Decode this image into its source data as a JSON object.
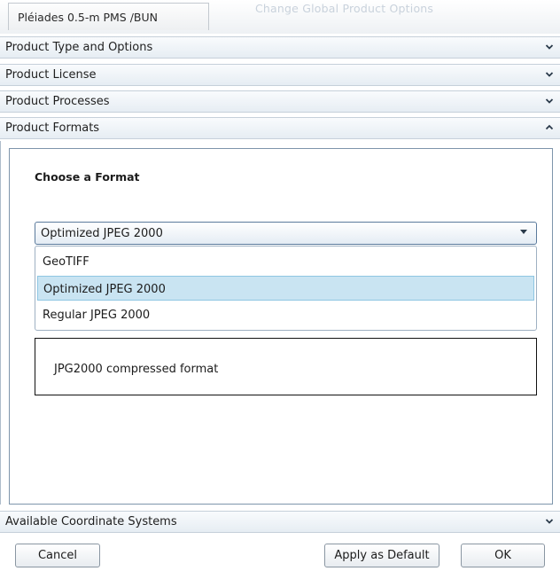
{
  "window": {
    "title": "Pléiades 0.5-m PMS /BUN",
    "ghost_title": "Change Global Product Options"
  },
  "accordion": {
    "sections": [
      {
        "label": "Product Type and Options",
        "state": "collapsed",
        "icon": "chevron-down-icon"
      },
      {
        "label": "Product License",
        "state": "collapsed",
        "icon": "chevron-down-icon"
      },
      {
        "label": "Product Processes",
        "state": "collapsed",
        "icon": "chevron-down-icon"
      },
      {
        "label": "Product Formats",
        "state": "expanded",
        "icon": "chevron-up-icon"
      },
      {
        "label": "Available Coordinate Systems",
        "state": "collapsed",
        "icon": "chevron-down-icon"
      }
    ]
  },
  "formats": {
    "heading": "Choose a Format",
    "selected_value": "Optimized JPEG 2000",
    "options": [
      "GeoTIFF",
      "Optimized JPEG 2000",
      "Regular JPEG 2000"
    ],
    "highlighted_index": 1,
    "description": "JPG2000 compressed format"
  },
  "buttons": {
    "cancel": "Cancel",
    "apply_default": "Apply as Default",
    "ok": "OK"
  },
  "colors": {
    "header_border": "#c6d0da",
    "selection_bg": "#c9e4f2",
    "panel_border": "#7e95ab"
  }
}
